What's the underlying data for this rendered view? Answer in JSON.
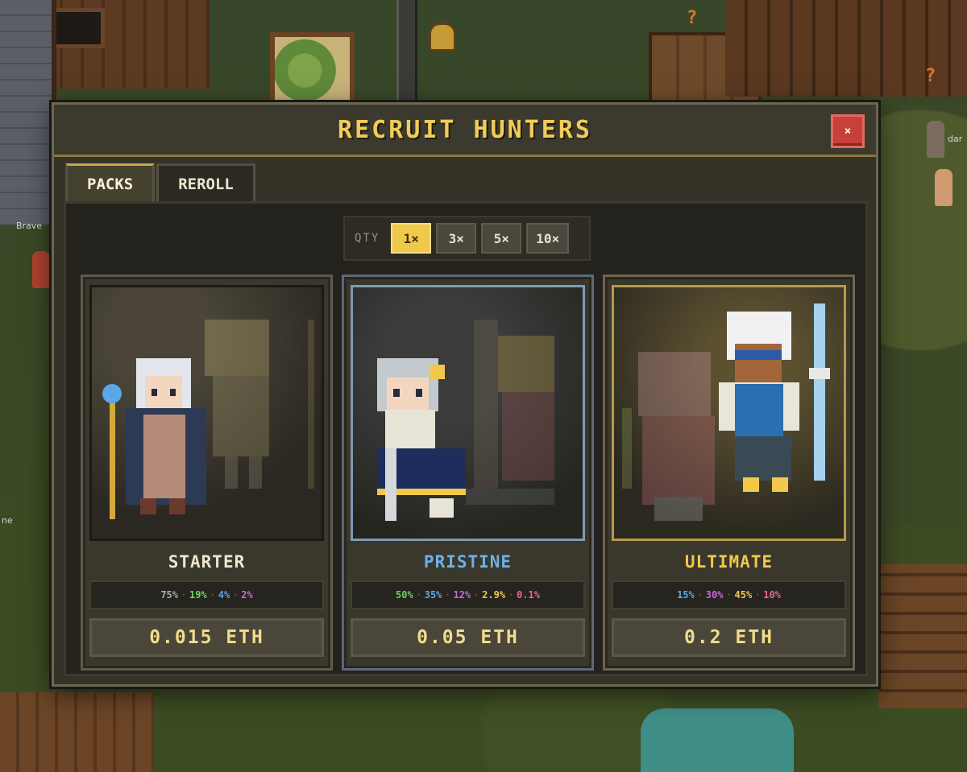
{
  "modal": {
    "title": "RECRUIT HUNTERS",
    "close_label": "×"
  },
  "tabs": [
    {
      "label": "PACKS",
      "active": true
    },
    {
      "label": "REROLL",
      "active": false
    }
  ],
  "qty": {
    "label": "QTY",
    "options": [
      "1×",
      "3×",
      "5×",
      "10×"
    ],
    "selected": "1×"
  },
  "packs": [
    {
      "name": "STARTER",
      "price": "0.015 ETH",
      "rates": [
        {
          "text": "75%",
          "color": "#a9a9a9"
        },
        {
          "text": "19%",
          "color": "#6fd06a"
        },
        {
          "text": "4%",
          "color": "#5aa7e6"
        },
        {
          "text": "2%",
          "color": "#c56ad8"
        }
      ]
    },
    {
      "name": "PRISTINE",
      "price": "0.05 ETH",
      "rates": [
        {
          "text": "50%",
          "color": "#6fd06a"
        },
        {
          "text": "35%",
          "color": "#5aa7e6"
        },
        {
          "text": "12%",
          "color": "#c56ad8"
        },
        {
          "text": "2.9%",
          "color": "#f0c94a"
        },
        {
          "text": "0.1%",
          "color": "#e8689a"
        }
      ]
    },
    {
      "name": "ULTIMATE",
      "price": "0.2 ETH",
      "rates": [
        {
          "text": "15%",
          "color": "#5aa7e6"
        },
        {
          "text": "30%",
          "color": "#c56ad8"
        },
        {
          "text": "45%",
          "color": "#f0c94a"
        },
        {
          "text": "10%",
          "color": "#e8689a"
        }
      ]
    }
  ],
  "background": {
    "labels": [
      "Brave",
      "dar",
      "ne"
    ]
  },
  "colors": {
    "title": "#f0cd5a",
    "accent_gold": "#f0c94a",
    "pristine_blue": "#6fb0e6",
    "close_red": "#c8403a"
  }
}
